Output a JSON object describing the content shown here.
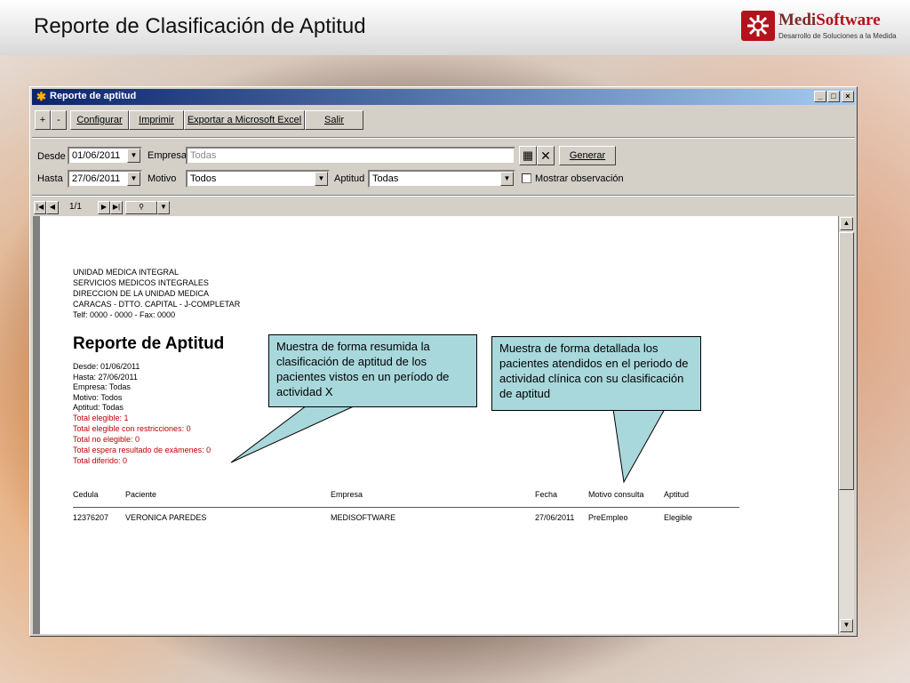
{
  "slide": {
    "title": "Reporte de Clasificación de Aptitud",
    "logo_name_bold": "Medi",
    "logo_name_rest": "Software",
    "logo_tagline": "Desarrollo de Soluciones a la Medida"
  },
  "window": {
    "title": "Reporte de aptitud",
    "btn_min": "_",
    "btn_max": "□",
    "btn_close": "×"
  },
  "toolbar": {
    "plus": "+",
    "minus": "-",
    "configurar": "Configurar",
    "imprimir": "Imprimir",
    "exportar": "Exportar a Microsoft Excel",
    "salir": "Salir"
  },
  "filters": {
    "desde_label": "Desde",
    "desde_value": "01/06/2011",
    "hasta_label": "Hasta",
    "hasta_value": "27/06/2011",
    "empresa_label": "Empresa",
    "empresa_value": "Todas",
    "motivo_label": "Motivo",
    "motivo_value": "Todos",
    "aptitud_label": "Aptitud",
    "aptitud_value": "Todas",
    "generar": "Generar",
    "mostrar_observacion": "Mostrar observación"
  },
  "navigator": {
    "page": "1/1"
  },
  "report": {
    "org_lines": [
      "UNIDAD MEDICA INTEGRAL",
      "SERVICIOS MEDICOS INTEGRALES",
      "DIRECCION DE LA UNIDAD MEDICA",
      "CARACAS - DTTO. CAPITAL - J-COMPLETAR",
      "Telf: 0000 - 0000 - Fax: 0000"
    ],
    "title": "Reporte de Aptitud",
    "params": [
      "Desde: 01/06/2011",
      "Hasta: 27/06/2011",
      "Empresa: Todas",
      "Motivo: Todos",
      "Aptitud: Todas"
    ],
    "totals": [
      "Total elegible: 1",
      "Total elegible con restricciones: 0",
      "Total no elegible: 0",
      "Total espera resultado de exámenes: 0",
      "Total diferido: 0"
    ],
    "columns": [
      "Cedula",
      "Paciente",
      "Empresa",
      "Fecha",
      "Motivo consulta",
      "Aptitud"
    ],
    "rows": [
      [
        "12376207",
        "VERONICA PAREDES",
        "MEDISOFTWARE",
        "27/06/2011",
        "PreEmpleo",
        "Elegible"
      ]
    ]
  },
  "callouts": {
    "left": "Muestra de forma resumida la clasificación de aptitud de los pacientes vistos en un período de actividad X",
    "right": "Muestra de forma detallada los pacientes atendidos en el periodo de actividad clínica con su clasificación de aptitud"
  },
  "colors": {
    "titlebar": "#0a246a",
    "callout": "#a8d8dc",
    "totals_red": "#c00000",
    "logo_red": "#b5121b"
  }
}
